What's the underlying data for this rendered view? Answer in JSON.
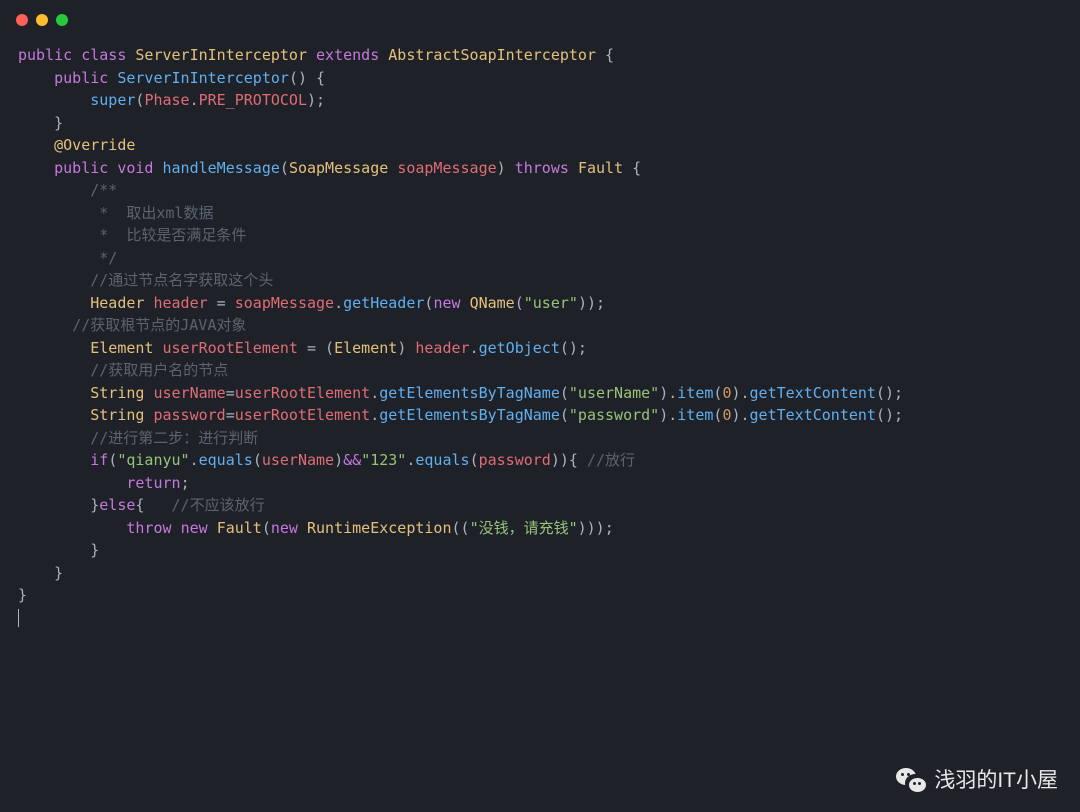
{
  "window": {
    "controls": [
      "close",
      "minimize",
      "maximize"
    ]
  },
  "code": {
    "lines": [
      [
        {
          "c": "k",
          "t": "public"
        },
        {
          "c": "p",
          "t": " "
        },
        {
          "c": "k",
          "t": "class"
        },
        {
          "c": "p",
          "t": " "
        },
        {
          "c": "t",
          "t": "ServerInInterceptor"
        },
        {
          "c": "p",
          "t": " "
        },
        {
          "c": "k",
          "t": "extends"
        },
        {
          "c": "p",
          "t": " "
        },
        {
          "c": "t",
          "t": "AbstractSoapInterceptor"
        },
        {
          "c": "p",
          "t": " {"
        }
      ],
      [
        {
          "c": "p",
          "t": "    "
        },
        {
          "c": "k",
          "t": "public"
        },
        {
          "c": "p",
          "t": " "
        },
        {
          "c": "m",
          "t": "ServerInInterceptor"
        },
        {
          "c": "p",
          "t": "() {"
        }
      ],
      [
        {
          "c": "p",
          "t": "        "
        },
        {
          "c": "m",
          "t": "super"
        },
        {
          "c": "p",
          "t": "("
        },
        {
          "c": "v",
          "t": "Phase"
        },
        {
          "c": "p",
          "t": "."
        },
        {
          "c": "v",
          "t": "PRE_PROTOCOL"
        },
        {
          "c": "p",
          "t": ");"
        }
      ],
      [
        {
          "c": "p",
          "t": "    }"
        }
      ],
      [
        {
          "c": "p",
          "t": ""
        }
      ],
      [
        {
          "c": "p",
          "t": "    "
        },
        {
          "c": "a",
          "t": "@Override"
        }
      ],
      [
        {
          "c": "p",
          "t": "    "
        },
        {
          "c": "k",
          "t": "public"
        },
        {
          "c": "p",
          "t": " "
        },
        {
          "c": "k",
          "t": "void"
        },
        {
          "c": "p",
          "t": " "
        },
        {
          "c": "m",
          "t": "handleMessage"
        },
        {
          "c": "p",
          "t": "("
        },
        {
          "c": "t",
          "t": "SoapMessage"
        },
        {
          "c": "p",
          "t": " "
        },
        {
          "c": "v",
          "t": "soapMessage"
        },
        {
          "c": "p",
          "t": ") "
        },
        {
          "c": "k",
          "t": "throws"
        },
        {
          "c": "p",
          "t": " "
        },
        {
          "c": "t",
          "t": "Fault"
        },
        {
          "c": "p",
          "t": " {"
        }
      ],
      [
        {
          "c": "p",
          "t": ""
        }
      ],
      [
        {
          "c": "p",
          "t": "        "
        },
        {
          "c": "c",
          "t": "/**"
        }
      ],
      [
        {
          "c": "p",
          "t": "        "
        },
        {
          "c": "c",
          "t": " *  取出xml数据"
        }
      ],
      [
        {
          "c": "p",
          "t": "        "
        },
        {
          "c": "c",
          "t": " *  比较是否满足条件"
        }
      ],
      [
        {
          "c": "p",
          "t": "        "
        },
        {
          "c": "c",
          "t": " */"
        }
      ],
      [
        {
          "c": "p",
          "t": "        "
        },
        {
          "c": "c",
          "t": "//通过节点名字获取这个头"
        }
      ],
      [
        {
          "c": "p",
          "t": "        "
        },
        {
          "c": "t",
          "t": "Header"
        },
        {
          "c": "p",
          "t": " "
        },
        {
          "c": "v",
          "t": "header"
        },
        {
          "c": "p",
          "t": " = "
        },
        {
          "c": "v",
          "t": "soapMessage"
        },
        {
          "c": "p",
          "t": "."
        },
        {
          "c": "m",
          "t": "getHeader"
        },
        {
          "c": "p",
          "t": "("
        },
        {
          "c": "k",
          "t": "new"
        },
        {
          "c": "p",
          "t": " "
        },
        {
          "c": "t",
          "t": "QName"
        },
        {
          "c": "p",
          "t": "("
        },
        {
          "c": "s",
          "t": "\"user\""
        },
        {
          "c": "p",
          "t": "));"
        }
      ],
      [
        {
          "c": "p",
          "t": "      "
        },
        {
          "c": "c",
          "t": "//获取根节点的JAVA对象"
        }
      ],
      [
        {
          "c": "p",
          "t": "        "
        },
        {
          "c": "t",
          "t": "Element"
        },
        {
          "c": "p",
          "t": " "
        },
        {
          "c": "v",
          "t": "userRootElement"
        },
        {
          "c": "p",
          "t": " = ("
        },
        {
          "c": "t",
          "t": "Element"
        },
        {
          "c": "p",
          "t": ") "
        },
        {
          "c": "v",
          "t": "header"
        },
        {
          "c": "p",
          "t": "."
        },
        {
          "c": "m",
          "t": "getObject"
        },
        {
          "c": "p",
          "t": "();"
        }
      ],
      [
        {
          "c": "p",
          "t": "        "
        },
        {
          "c": "c",
          "t": "//获取用户名的节点"
        }
      ],
      [
        {
          "c": "p",
          "t": "        "
        },
        {
          "c": "t",
          "t": "String"
        },
        {
          "c": "p",
          "t": " "
        },
        {
          "c": "v",
          "t": "userName"
        },
        {
          "c": "p",
          "t": "="
        },
        {
          "c": "v",
          "t": "userRootElement"
        },
        {
          "c": "p",
          "t": "."
        },
        {
          "c": "m",
          "t": "getElementsByTagName"
        },
        {
          "c": "p",
          "t": "("
        },
        {
          "c": "s",
          "t": "\"userName\""
        },
        {
          "c": "p",
          "t": ")."
        },
        {
          "c": "m",
          "t": "item"
        },
        {
          "c": "p",
          "t": "("
        },
        {
          "c": "n",
          "t": "0"
        },
        {
          "c": "p",
          "t": ")."
        },
        {
          "c": "m",
          "t": "getTextContent"
        },
        {
          "c": "p",
          "t": "();"
        }
      ],
      [
        {
          "c": "p",
          "t": "        "
        },
        {
          "c": "t",
          "t": "String"
        },
        {
          "c": "p",
          "t": " "
        },
        {
          "c": "v",
          "t": "password"
        },
        {
          "c": "p",
          "t": "="
        },
        {
          "c": "v",
          "t": "userRootElement"
        },
        {
          "c": "p",
          "t": "."
        },
        {
          "c": "m",
          "t": "getElementsByTagName"
        },
        {
          "c": "p",
          "t": "("
        },
        {
          "c": "s",
          "t": "\"password\""
        },
        {
          "c": "p",
          "t": ")."
        },
        {
          "c": "m",
          "t": "item"
        },
        {
          "c": "p",
          "t": "("
        },
        {
          "c": "n",
          "t": "0"
        },
        {
          "c": "p",
          "t": ")."
        },
        {
          "c": "m",
          "t": "getTextContent"
        },
        {
          "c": "p",
          "t": "();"
        }
      ],
      [
        {
          "c": "p",
          "t": ""
        }
      ],
      [
        {
          "c": "p",
          "t": "        "
        },
        {
          "c": "c",
          "t": "//进行第二步：进行判断"
        }
      ],
      [
        {
          "c": "p",
          "t": "        "
        },
        {
          "c": "k",
          "t": "if"
        },
        {
          "c": "p",
          "t": "("
        },
        {
          "c": "s",
          "t": "\"qianyu\""
        },
        {
          "c": "p",
          "t": "."
        },
        {
          "c": "m",
          "t": "equals"
        },
        {
          "c": "p",
          "t": "("
        },
        {
          "c": "v",
          "t": "userName"
        },
        {
          "c": "p",
          "t": ")"
        },
        {
          "c": "k",
          "t": "&&"
        },
        {
          "c": "s",
          "t": "\"123\""
        },
        {
          "c": "p",
          "t": "."
        },
        {
          "c": "m",
          "t": "equals"
        },
        {
          "c": "p",
          "t": "("
        },
        {
          "c": "v",
          "t": "password"
        },
        {
          "c": "p",
          "t": ")){ "
        },
        {
          "c": "c",
          "t": "//放行"
        }
      ],
      [
        {
          "c": "p",
          "t": ""
        }
      ],
      [
        {
          "c": "p",
          "t": "            "
        },
        {
          "c": "k",
          "t": "return"
        },
        {
          "c": "p",
          "t": ";"
        }
      ],
      [
        {
          "c": "p",
          "t": "        }"
        },
        {
          "c": "k",
          "t": "else"
        },
        {
          "c": "p",
          "t": "{   "
        },
        {
          "c": "c",
          "t": "//不应该放行"
        }
      ],
      [
        {
          "c": "p",
          "t": "            "
        },
        {
          "c": "k",
          "t": "throw"
        },
        {
          "c": "p",
          "t": " "
        },
        {
          "c": "k",
          "t": "new"
        },
        {
          "c": "p",
          "t": " "
        },
        {
          "c": "t",
          "t": "Fault"
        },
        {
          "c": "p",
          "t": "("
        },
        {
          "c": "k",
          "t": "new"
        },
        {
          "c": "p",
          "t": " "
        },
        {
          "c": "t",
          "t": "RuntimeException"
        },
        {
          "c": "p",
          "t": "(("
        },
        {
          "c": "s",
          "t": "\"没钱，请充钱\""
        },
        {
          "c": "p",
          "t": ")));"
        }
      ],
      [
        {
          "c": "p",
          "t": "        }"
        }
      ],
      [
        {
          "c": "p",
          "t": ""
        }
      ],
      [
        {
          "c": "p",
          "t": ""
        }
      ],
      [
        {
          "c": "p",
          "t": "    }"
        }
      ],
      [
        {
          "c": "p",
          "t": "}"
        }
      ]
    ]
  },
  "watermark": {
    "text": "浅羽的IT小屋"
  }
}
